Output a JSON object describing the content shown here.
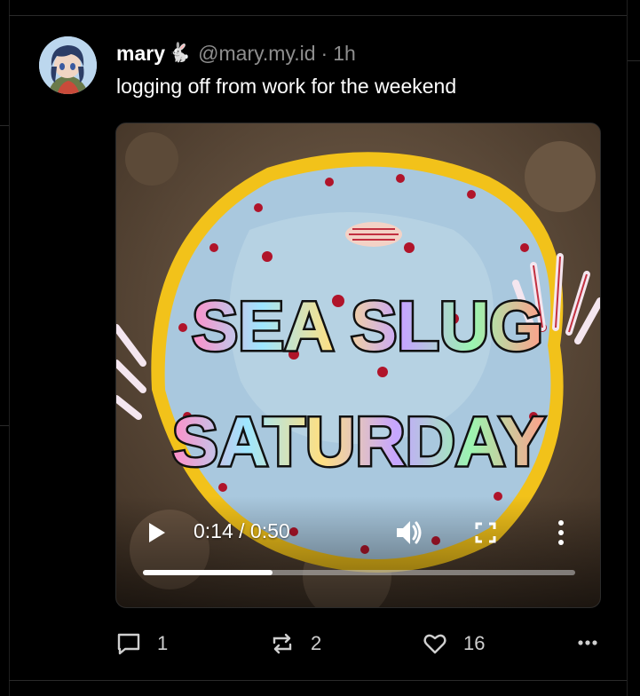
{
  "post": {
    "author": {
      "display_name": "mary",
      "badge": "🐇",
      "handle": "@mary.my.id",
      "separator": "·",
      "time": "1h",
      "avatar_icon": "anime-girl-avatar-icon"
    },
    "text": "logging off from work for the weekend",
    "video": {
      "overlay_text_line1": "SEA SLUG",
      "overlay_text_line2": "SATURDAY",
      "timecode": "0:14 / 0:50",
      "progress": 0.3,
      "icons": [
        "play-icon",
        "volume-icon",
        "fullscreen-icon",
        "more-vertical-icon"
      ]
    },
    "actions": {
      "reply_count": "1",
      "repost_count": "2",
      "like_count": "16",
      "icons": [
        "reply-icon",
        "repost-icon",
        "heart-icon",
        "more-horizontal-icon"
      ]
    }
  },
  "colors": {
    "background": "#000000",
    "text": "#ffffff",
    "muted": "#8e8e8e",
    "divider": "#2a2a2a"
  }
}
